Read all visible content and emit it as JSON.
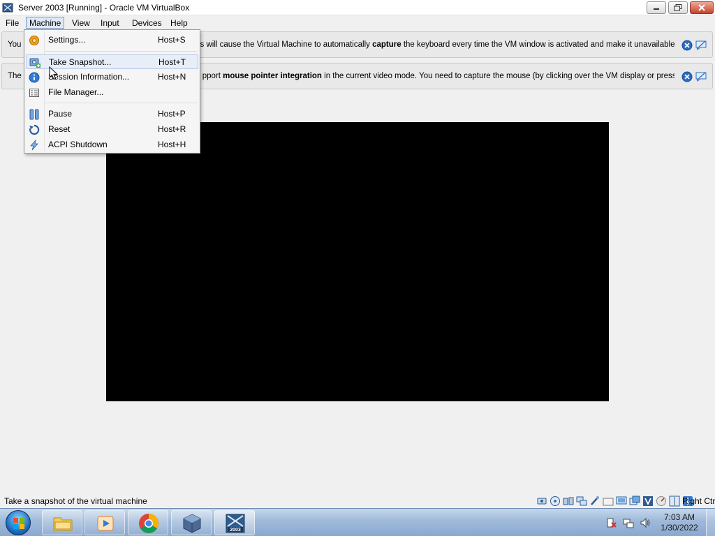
{
  "window": {
    "title": "Server 2003 [Running] - Oracle VM VirtualBox"
  },
  "menubar": {
    "items": [
      {
        "label": "File"
      },
      {
        "label": "Machine"
      },
      {
        "label": "View"
      },
      {
        "label": "Input"
      },
      {
        "label": "Devices"
      },
      {
        "label": "Help"
      }
    ]
  },
  "banners": {
    "keyboard": {
      "prefix": "You h",
      "middle": "n. This will cause the Virtual Machine to automatically ",
      "bold": "capture",
      "suffix": " the keyboard every time the VM window is activated and make it unavailable to"
    },
    "mouse": {
      "prefix": "The V",
      "middle": "pport ",
      "bold": "mouse pointer integration",
      "suffix": " in the current video mode. You need to capture the mouse (by clicking over the VM display or pressing"
    }
  },
  "machine_menu": {
    "items": [
      {
        "label": "Settings...",
        "shortcut": "Host+S",
        "icon": "settings-gear-icon"
      },
      {
        "label": "Take Snapshot...",
        "shortcut": "Host+T",
        "icon": "snapshot-icon"
      },
      {
        "label": "Session Information...",
        "shortcut": "Host+N",
        "icon": "info-icon"
      },
      {
        "label": "File Manager...",
        "shortcut": "",
        "icon": "file-manager-icon"
      },
      {
        "label": "Pause",
        "shortcut": "Host+P",
        "icon": "pause-icon"
      },
      {
        "label": "Reset",
        "shortcut": "Host+R",
        "icon": "reset-icon"
      },
      {
        "label": "ACPI Shutdown",
        "shortcut": "Host+H",
        "icon": "acpi-shutdown-icon"
      }
    ],
    "highlighted": "Take Snapshot..."
  },
  "statusbar": {
    "text": "Take a snapshot of the virtual machine",
    "host_key": "Right Ctrl",
    "icons": [
      "hard-disk-icon",
      "optical-drive-icon",
      "audio-icon",
      "network-icon",
      "usb-icon",
      "shared-folders-icon",
      "display-icon",
      "video-capture-icon",
      "virtualization-icon",
      "cpu-icon",
      "mouse-integration-icon",
      "keyboard-capture-icon"
    ]
  },
  "taskbar": {
    "apps": [
      {
        "name": "windows-explorer",
        "icon": "folder-icon"
      },
      {
        "name": "media-player",
        "icon": "media-player-icon"
      },
      {
        "name": "chrome",
        "icon": "chrome-icon"
      },
      {
        "name": "virtualbox-manager",
        "icon": "virtualbox-icon"
      },
      {
        "name": "server-2003-vm",
        "icon": "server-2003-icon",
        "label": "2003"
      }
    ],
    "clock_time": "7:03 AM",
    "clock_date": "1/30/2022"
  },
  "colors": {
    "vm_screen": "#000000",
    "menu_highlight": "#e8eef8",
    "taskbar": "#9fb9d9"
  }
}
